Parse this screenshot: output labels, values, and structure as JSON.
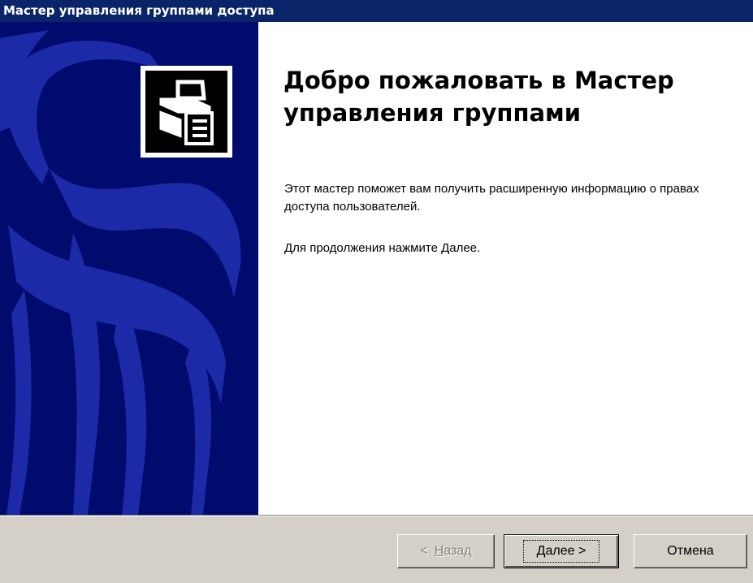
{
  "window": {
    "title": "Мастер управления группами доступа"
  },
  "side_panel": {
    "background_color": "#000b6e",
    "graphic_color": "#1d2aa8",
    "icon": "wizard-computer-icon"
  },
  "content": {
    "heading": "Добро пожаловать в Мастер управления группами",
    "paragraph1": "Этот мастер поможет вам получить расширенную информацию о правах доступа пользователей.",
    "paragraph2": "Для продолжения нажмите Далее."
  },
  "buttons": {
    "back": {
      "prefix": "<",
      "mnemonic": "Н",
      "rest": "азад",
      "enabled": false
    },
    "next": {
      "mnemonic": "Д",
      "rest": "алее",
      "suffix": ">",
      "enabled": true,
      "default": true
    },
    "cancel": {
      "label": "Отмена",
      "enabled": true
    }
  },
  "colors": {
    "titlebar": "#0a246a",
    "face": "#d4d0c8"
  }
}
